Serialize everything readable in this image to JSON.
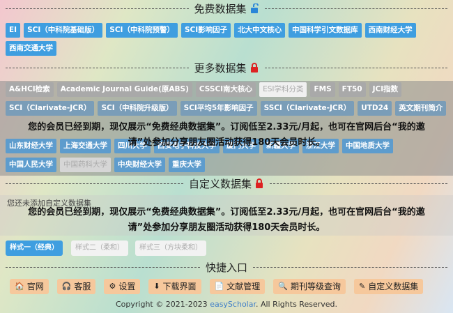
{
  "free": {
    "title": "免费数据集",
    "tags": [
      "EI",
      "SCI（中科院基础版）",
      "SCI（中科院预警）",
      "SCI影响因子",
      "北大中文核心",
      "中国科学引文数据库",
      "西南财经大学",
      "西南交通大学"
    ]
  },
  "more": {
    "title": "更多数据集",
    "row1": [
      "A&HCI检索",
      "Academic Journal Guide(原ABS)",
      "CSSCI南大核心",
      "ESI学科分类",
      "FMS",
      "FT50",
      "JCI指数"
    ],
    "row2": [
      "SCI（Clarivate-JCR）",
      "SCI（中科院升级版）",
      "SCI平均5年影响因子",
      "SSCI（Clarivate-JCR）",
      "UTD24",
      "英文期刊简介"
    ],
    "row3": [
      "山东财经大学",
      "上海交通大学",
      "四川大学",
      "西安电子科技大学",
      "厦门大学",
      "新疆大学",
      "浙江大学",
      "中国地质大学"
    ],
    "row4": [
      "中国人民大学",
      "中国药科大学",
      "中央财经大学",
      "重庆大学"
    ]
  },
  "notice": {
    "line1": "您的会员已经到期，现仅展示“免费经典数据集”。订阅低至2.33元/月起，也可在官网后台“我的邀",
    "line2": "请”处参加分享朋友圈活动获得180天会员时长。"
  },
  "custom": {
    "title": "自定义数据集",
    "empty": "您还未添加自定义数据集"
  },
  "styles": {
    "btn1": "样式一（经典）",
    "btn2": "样式二（柔和）",
    "btn3": "样式三（方块柔和）"
  },
  "quick": {
    "title": "快捷入口",
    "items": [
      {
        "icon": "🏠",
        "label": "官网"
      },
      {
        "icon": "🎧",
        "label": "客服"
      },
      {
        "icon": "⚙",
        "label": "设置"
      },
      {
        "icon": "⬇",
        "label": "下载界面"
      },
      {
        "icon": "📄",
        "label": "文献管理"
      },
      {
        "icon": "🔍",
        "label": "期刊等级查询"
      },
      {
        "icon": "✎",
        "label": "自定义数据集"
      }
    ]
  },
  "footer": {
    "prefix": "Copyright © 2021-2023 ",
    "brand": "easyScholar",
    "suffix": ". All Rights Reserved."
  },
  "colors": {
    "tag": "#3f9ee0",
    "lock_red": "#d22",
    "lock_blue": "#2a86d8",
    "quick": "#f6c89c"
  }
}
